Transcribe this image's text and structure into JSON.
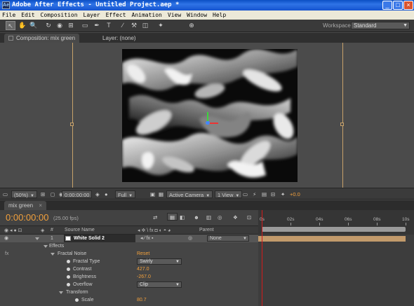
{
  "window": {
    "icon_text": "Ae",
    "title": "Adobe After Effects - Untitled Project.aep *",
    "minimize_glyph": "_",
    "maximize_glyph": "□",
    "close_glyph": "×"
  },
  "menu": [
    "File",
    "Edit",
    "Composition",
    "Layer",
    "Effect",
    "Animation",
    "View",
    "Window",
    "Help"
  ],
  "toolbar": {
    "tools": [
      {
        "name": "selection-tool-icon",
        "glyph": "↖",
        "active": true
      },
      {
        "name": "hand-tool-icon",
        "glyph": "✋"
      },
      {
        "name": "zoom-tool-icon",
        "glyph": "🔍"
      },
      {
        "name": "rotation-tool-icon",
        "glyph": "↻"
      },
      {
        "name": "camera-tool-icon",
        "glyph": "◉"
      },
      {
        "name": "pan-behind-tool-icon",
        "glyph": "⊞"
      },
      {
        "name": "mask-tool-icon",
        "glyph": "▭"
      },
      {
        "name": "pen-tool-icon",
        "glyph": "✒"
      },
      {
        "name": "type-tool-icon",
        "glyph": "T"
      },
      {
        "name": "brush-tool-icon",
        "glyph": "∕"
      },
      {
        "name": "clone-stamp-tool-icon",
        "glyph": "⚒"
      },
      {
        "name": "eraser-tool-icon",
        "glyph": "◫"
      },
      {
        "name": "puppet-tool-icon",
        "glyph": "✦"
      },
      {
        "name": "axis-mode-icon",
        "glyph": "⊕"
      }
    ],
    "workspace_label": "Workspace:",
    "workspace_value": "Standard"
  },
  "composition_panel": {
    "comp_tab": "Composition: mix green",
    "layer_tab": "Layer: (none)"
  },
  "viewer_bar": {
    "zoom": "(50%)",
    "timecode": "0:00:00:00",
    "resolution": "Full",
    "camera": "Active Camera",
    "views": "1 View",
    "exposure": "+0.0"
  },
  "timeline": {
    "tab": "mix green",
    "timecode": "0:00:00:00",
    "fps": "(25.00 fps)",
    "ruler_labels": [
      "0s",
      "02s",
      "04s",
      "06s",
      "08s",
      "10s"
    ],
    "columns": {
      "hash": "#",
      "source_name": "Source Name",
      "parent": "Parent"
    },
    "layer": {
      "index": "1",
      "name": "White Solid 2",
      "parent": "None"
    },
    "rows": [
      {
        "label": "Effects",
        "indent": 2,
        "twirl": true
      },
      {
        "label": "Fractal Noise",
        "indent": 3,
        "twirl": true,
        "fx": true,
        "value": "Reset",
        "value_style": "orange"
      },
      {
        "label": "Fractal Type",
        "indent": 4,
        "stopwatch": true,
        "value": "Swirly",
        "value_style": "select"
      },
      {
        "label": "Contrast",
        "indent": 4,
        "stopwatch": true,
        "value": "427.0",
        "value_style": "orange"
      },
      {
        "label": "Brightness",
        "indent": 4,
        "stopwatch": true,
        "value": "-267.0",
        "value_style": "orange"
      },
      {
        "label": "Overflow",
        "indent": 4,
        "stopwatch": true,
        "value": "Clip",
        "value_style": "select"
      },
      {
        "label": "Transform",
        "indent": 4,
        "twirl": true
      },
      {
        "label": "Scale",
        "indent": 5,
        "stopwatch": true,
        "value": "80.7",
        "value_style": "orange"
      }
    ]
  },
  "colors": {
    "accent": "#f2a03c",
    "guide": "#c8a26a",
    "layer_bar": "#c29a6b",
    "cti": "#d21b1b"
  }
}
